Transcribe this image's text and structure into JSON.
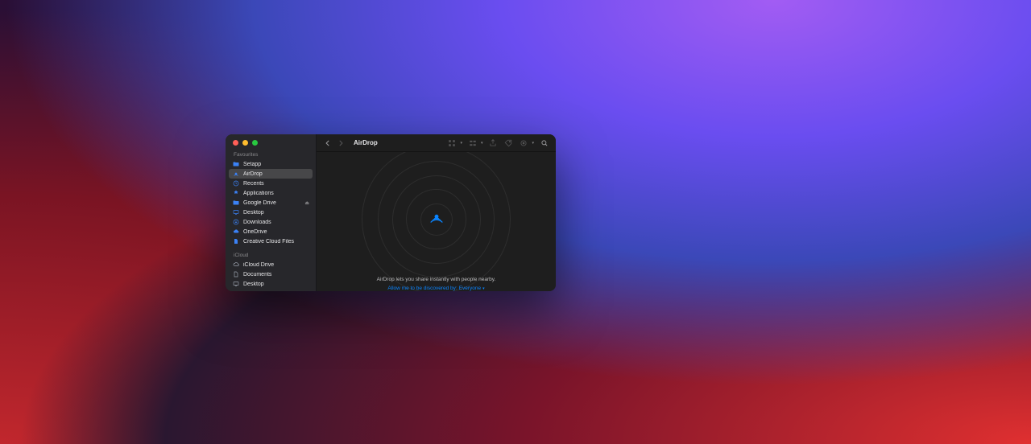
{
  "window": {
    "title": "AirDrop"
  },
  "sidebar": {
    "sections": [
      {
        "label": "Favourites",
        "items": [
          {
            "icon": "folder",
            "label": "Setapp"
          },
          {
            "icon": "airdrop",
            "label": "AirDrop",
            "selected": true
          },
          {
            "icon": "clock",
            "label": "Recents"
          },
          {
            "icon": "apps",
            "label": "Applications"
          },
          {
            "icon": "gdrive",
            "label": "Google Drive",
            "ejectable": true
          },
          {
            "icon": "desktop",
            "label": "Desktop"
          },
          {
            "icon": "download",
            "label": "Downloads"
          },
          {
            "icon": "cloud",
            "label": "OneDrive"
          },
          {
            "icon": "doc",
            "label": "Creative Cloud Files"
          }
        ]
      },
      {
        "label": "iCloud",
        "items": [
          {
            "icon": "icloud",
            "label": "iCloud Drive"
          },
          {
            "icon": "doc",
            "label": "Documents"
          },
          {
            "icon": "desktop",
            "label": "Desktop"
          }
        ]
      }
    ]
  },
  "content": {
    "info": "AirDrop lets you share instantly with people nearby.",
    "discover_prefix": "Allow me to be discovered by:",
    "discover_value": "Everyone"
  }
}
